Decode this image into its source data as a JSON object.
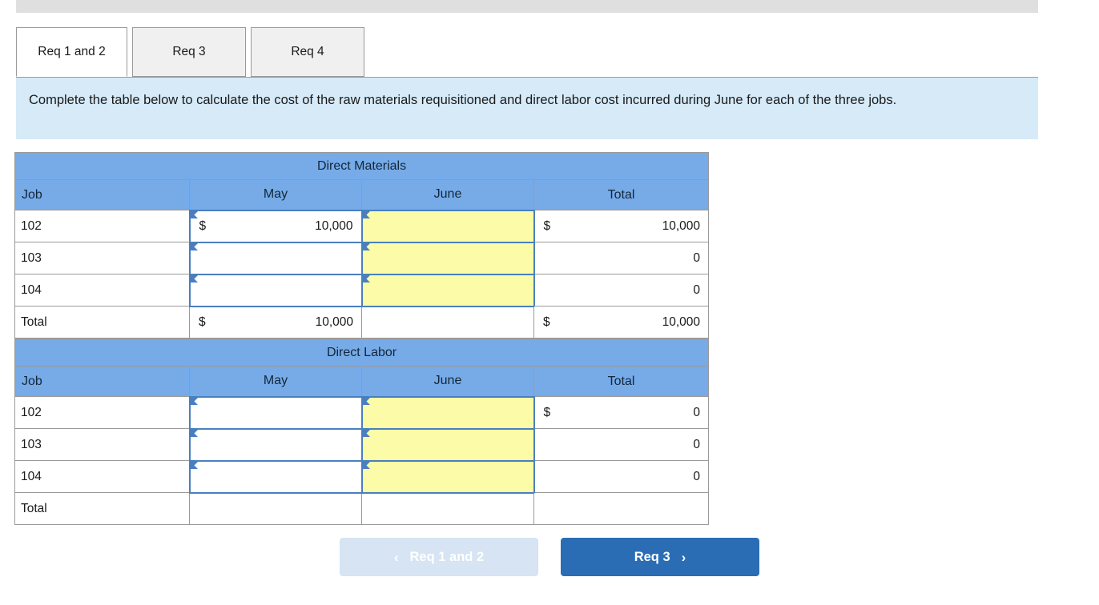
{
  "tabs": [
    {
      "label": "Req 1 and 2",
      "active": true
    },
    {
      "label": "Req 3",
      "active": false
    },
    {
      "label": "Req 4",
      "active": false
    }
  ],
  "instruction": {
    "text": "Complete the table below to calculate the cost of the raw materials requisitioned and direct labor cost incurred during June for each of the three jobs."
  },
  "colors": {
    "header_blue": "#76abe8",
    "input_yellow": "#fbfba8",
    "input_border": "#4a7fbf",
    "instruction_band": "#d6eaf8",
    "next_button": "#2a6db5",
    "prev_button": "#d6e4f3",
    "topbar_grey": "#dfdfdf"
  },
  "tables": [
    {
      "section_title": "Direct Materials",
      "columns": [
        "Job",
        "May",
        "June",
        "Total"
      ],
      "rows": [
        {
          "job": "102",
          "may": {
            "editable": true,
            "yellow": false,
            "symbol": "$",
            "amount": "10,000"
          },
          "june": {
            "editable": true,
            "yellow": true,
            "symbol": "",
            "amount": ""
          },
          "total": {
            "editable": false,
            "symbol": "$",
            "amount": "10,000"
          }
        },
        {
          "job": "103",
          "may": {
            "editable": true,
            "yellow": false,
            "symbol": "",
            "amount": ""
          },
          "june": {
            "editable": true,
            "yellow": true,
            "symbol": "",
            "amount": ""
          },
          "total": {
            "editable": false,
            "symbol": "",
            "amount": "0"
          }
        },
        {
          "job": "104",
          "may": {
            "editable": true,
            "yellow": false,
            "symbol": "",
            "amount": ""
          },
          "june": {
            "editable": true,
            "yellow": true,
            "symbol": "",
            "amount": ""
          },
          "total": {
            "editable": false,
            "symbol": "",
            "amount": "0"
          }
        }
      ],
      "total_row": {
        "job": "Total",
        "may": {
          "editable": false,
          "symbol": "$",
          "amount": "10,000"
        },
        "june": {
          "editable": false,
          "symbol": "",
          "amount": ""
        },
        "total": {
          "editable": false,
          "symbol": "$",
          "amount": "10,000"
        }
      }
    },
    {
      "section_title": "Direct Labor",
      "columns": [
        "Job",
        "May",
        "June",
        "Total"
      ],
      "rows": [
        {
          "job": "102",
          "may": {
            "editable": true,
            "yellow": false,
            "symbol": "",
            "amount": ""
          },
          "june": {
            "editable": true,
            "yellow": true,
            "symbol": "",
            "amount": ""
          },
          "total": {
            "editable": false,
            "symbol": "$",
            "amount": "0"
          }
        },
        {
          "job": "103",
          "may": {
            "editable": true,
            "yellow": false,
            "symbol": "",
            "amount": ""
          },
          "june": {
            "editable": true,
            "yellow": true,
            "symbol": "",
            "amount": ""
          },
          "total": {
            "editable": false,
            "symbol": "",
            "amount": "0"
          }
        },
        {
          "job": "104",
          "may": {
            "editable": true,
            "yellow": false,
            "symbol": "",
            "amount": ""
          },
          "june": {
            "editable": true,
            "yellow": true,
            "symbol": "",
            "amount": ""
          },
          "total": {
            "editable": false,
            "symbol": "",
            "amount": "0"
          }
        }
      ],
      "total_row": {
        "job": "Total",
        "may": {
          "editable": false,
          "symbol": "",
          "amount": ""
        },
        "june": {
          "editable": false,
          "symbol": "",
          "amount": ""
        },
        "total": {
          "editable": false,
          "symbol": "",
          "amount": ""
        }
      }
    }
  ],
  "footer": {
    "prev_label": "Req 1 and 2",
    "prev_chevron": "‹",
    "next_label": "Req 3",
    "next_chevron": "›"
  }
}
